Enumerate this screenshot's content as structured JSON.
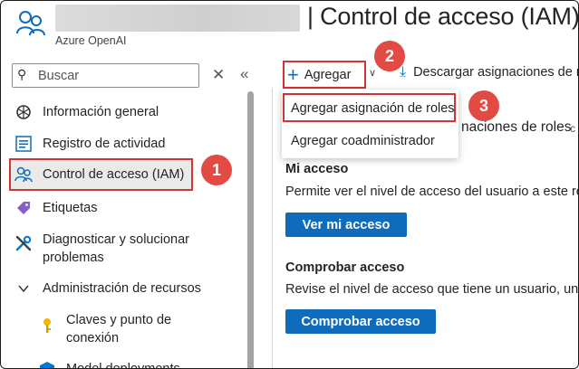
{
  "header": {
    "title": "| Control de acceso (IAM)",
    "subtitle": "Azure OpenAI",
    "resource_icon": "people-icon"
  },
  "sidebar": {
    "search_placeholder": "Buscar",
    "items": [
      {
        "label": "Información general",
        "icon": "openai-icon"
      },
      {
        "label": "Registro de actividad",
        "icon": "activity-log-icon"
      },
      {
        "label": "Control de acceso (IAM)",
        "icon": "people-icon",
        "active": true
      },
      {
        "label": "Etiquetas",
        "icon": "tag-icon"
      },
      {
        "label": "Diagnosticar y solucionar\nproblemas",
        "label_line1": "Diagnosticar y solucionar",
        "label_line2": "problemas",
        "icon": "wrench-icon"
      },
      {
        "label": "Administración de recursos",
        "icon": "chevron-down-icon"
      },
      {
        "label_line1": "Claves y punto de",
        "label_line2": "conexión",
        "icon": "key-icon"
      },
      {
        "label": "Model deployments",
        "icon": "cube-icon"
      }
    ]
  },
  "toolbar": {
    "add_label": "Agregar",
    "download_label": "Descargar asignaciones de r"
  },
  "dropdown": {
    "items": [
      "Agregar asignación de roles",
      "Agregar coadministrador"
    ]
  },
  "content": {
    "behind_menu_text": "naciones de roles",
    "my_access": {
      "title": "Mi acceso",
      "description": "Permite ver el nivel de acceso del usuario a este rec",
      "button": "Ver mi acceso"
    },
    "check_access": {
      "title": "Comprobar acceso",
      "description": "Revise el nivel de acceso que tiene un usuario, un g",
      "button": "Comprobar acceso"
    }
  },
  "callouts": [
    "1",
    "2",
    "3"
  ],
  "colors": {
    "accent": "#0f6cbd",
    "highlight": "#d13438",
    "badge": "#e24a44"
  }
}
